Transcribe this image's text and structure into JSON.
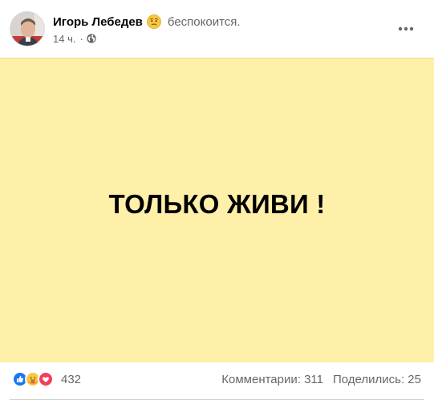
{
  "post": {
    "author_name": "Игорь Лебедев",
    "feeling_icon": "worried-face-icon",
    "feeling_text": "беспокоится.",
    "timestamp": "14 ч.",
    "separator": "·",
    "privacy_icon": "globe-icon",
    "more_icon": "more-options-icon",
    "content_text": "ТОЛЬКО ЖИВИ !",
    "content_bg": "#fff0a9"
  },
  "footer": {
    "reaction_icons": [
      "like-icon",
      "care-icon",
      "love-icon"
    ],
    "reaction_count": "432",
    "comments": "Комментарии: 311",
    "shares": "Поделились: 25"
  }
}
